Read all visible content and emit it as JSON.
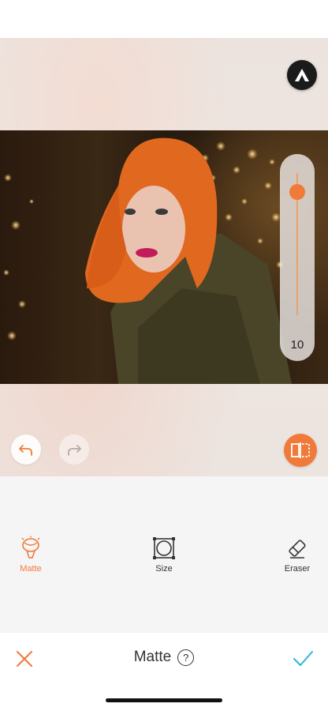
{
  "canvas": {
    "slider": {
      "value": "10",
      "level": 0.1
    },
    "accent_color": "#f07a3a",
    "icons": {
      "logo": "airbrush-logo-icon",
      "undo": "undo-arrow-icon",
      "redo": "redo-arrow-icon",
      "compare": "compare-icon"
    }
  },
  "tools": [
    {
      "label": "Matte",
      "icon": "matte-brush-icon",
      "active": true
    },
    {
      "label": "Size",
      "icon": "size-frame-icon",
      "active": false
    },
    {
      "label": "Eraser",
      "icon": "eraser-icon",
      "active": false
    }
  ],
  "bottom_bar": {
    "title": "Matte",
    "help": "?",
    "cancel_icon": "close-x-icon",
    "confirm_icon": "checkmark-icon",
    "cancel_color": "#f07a3a",
    "confirm_color": "#2bb6d6"
  }
}
